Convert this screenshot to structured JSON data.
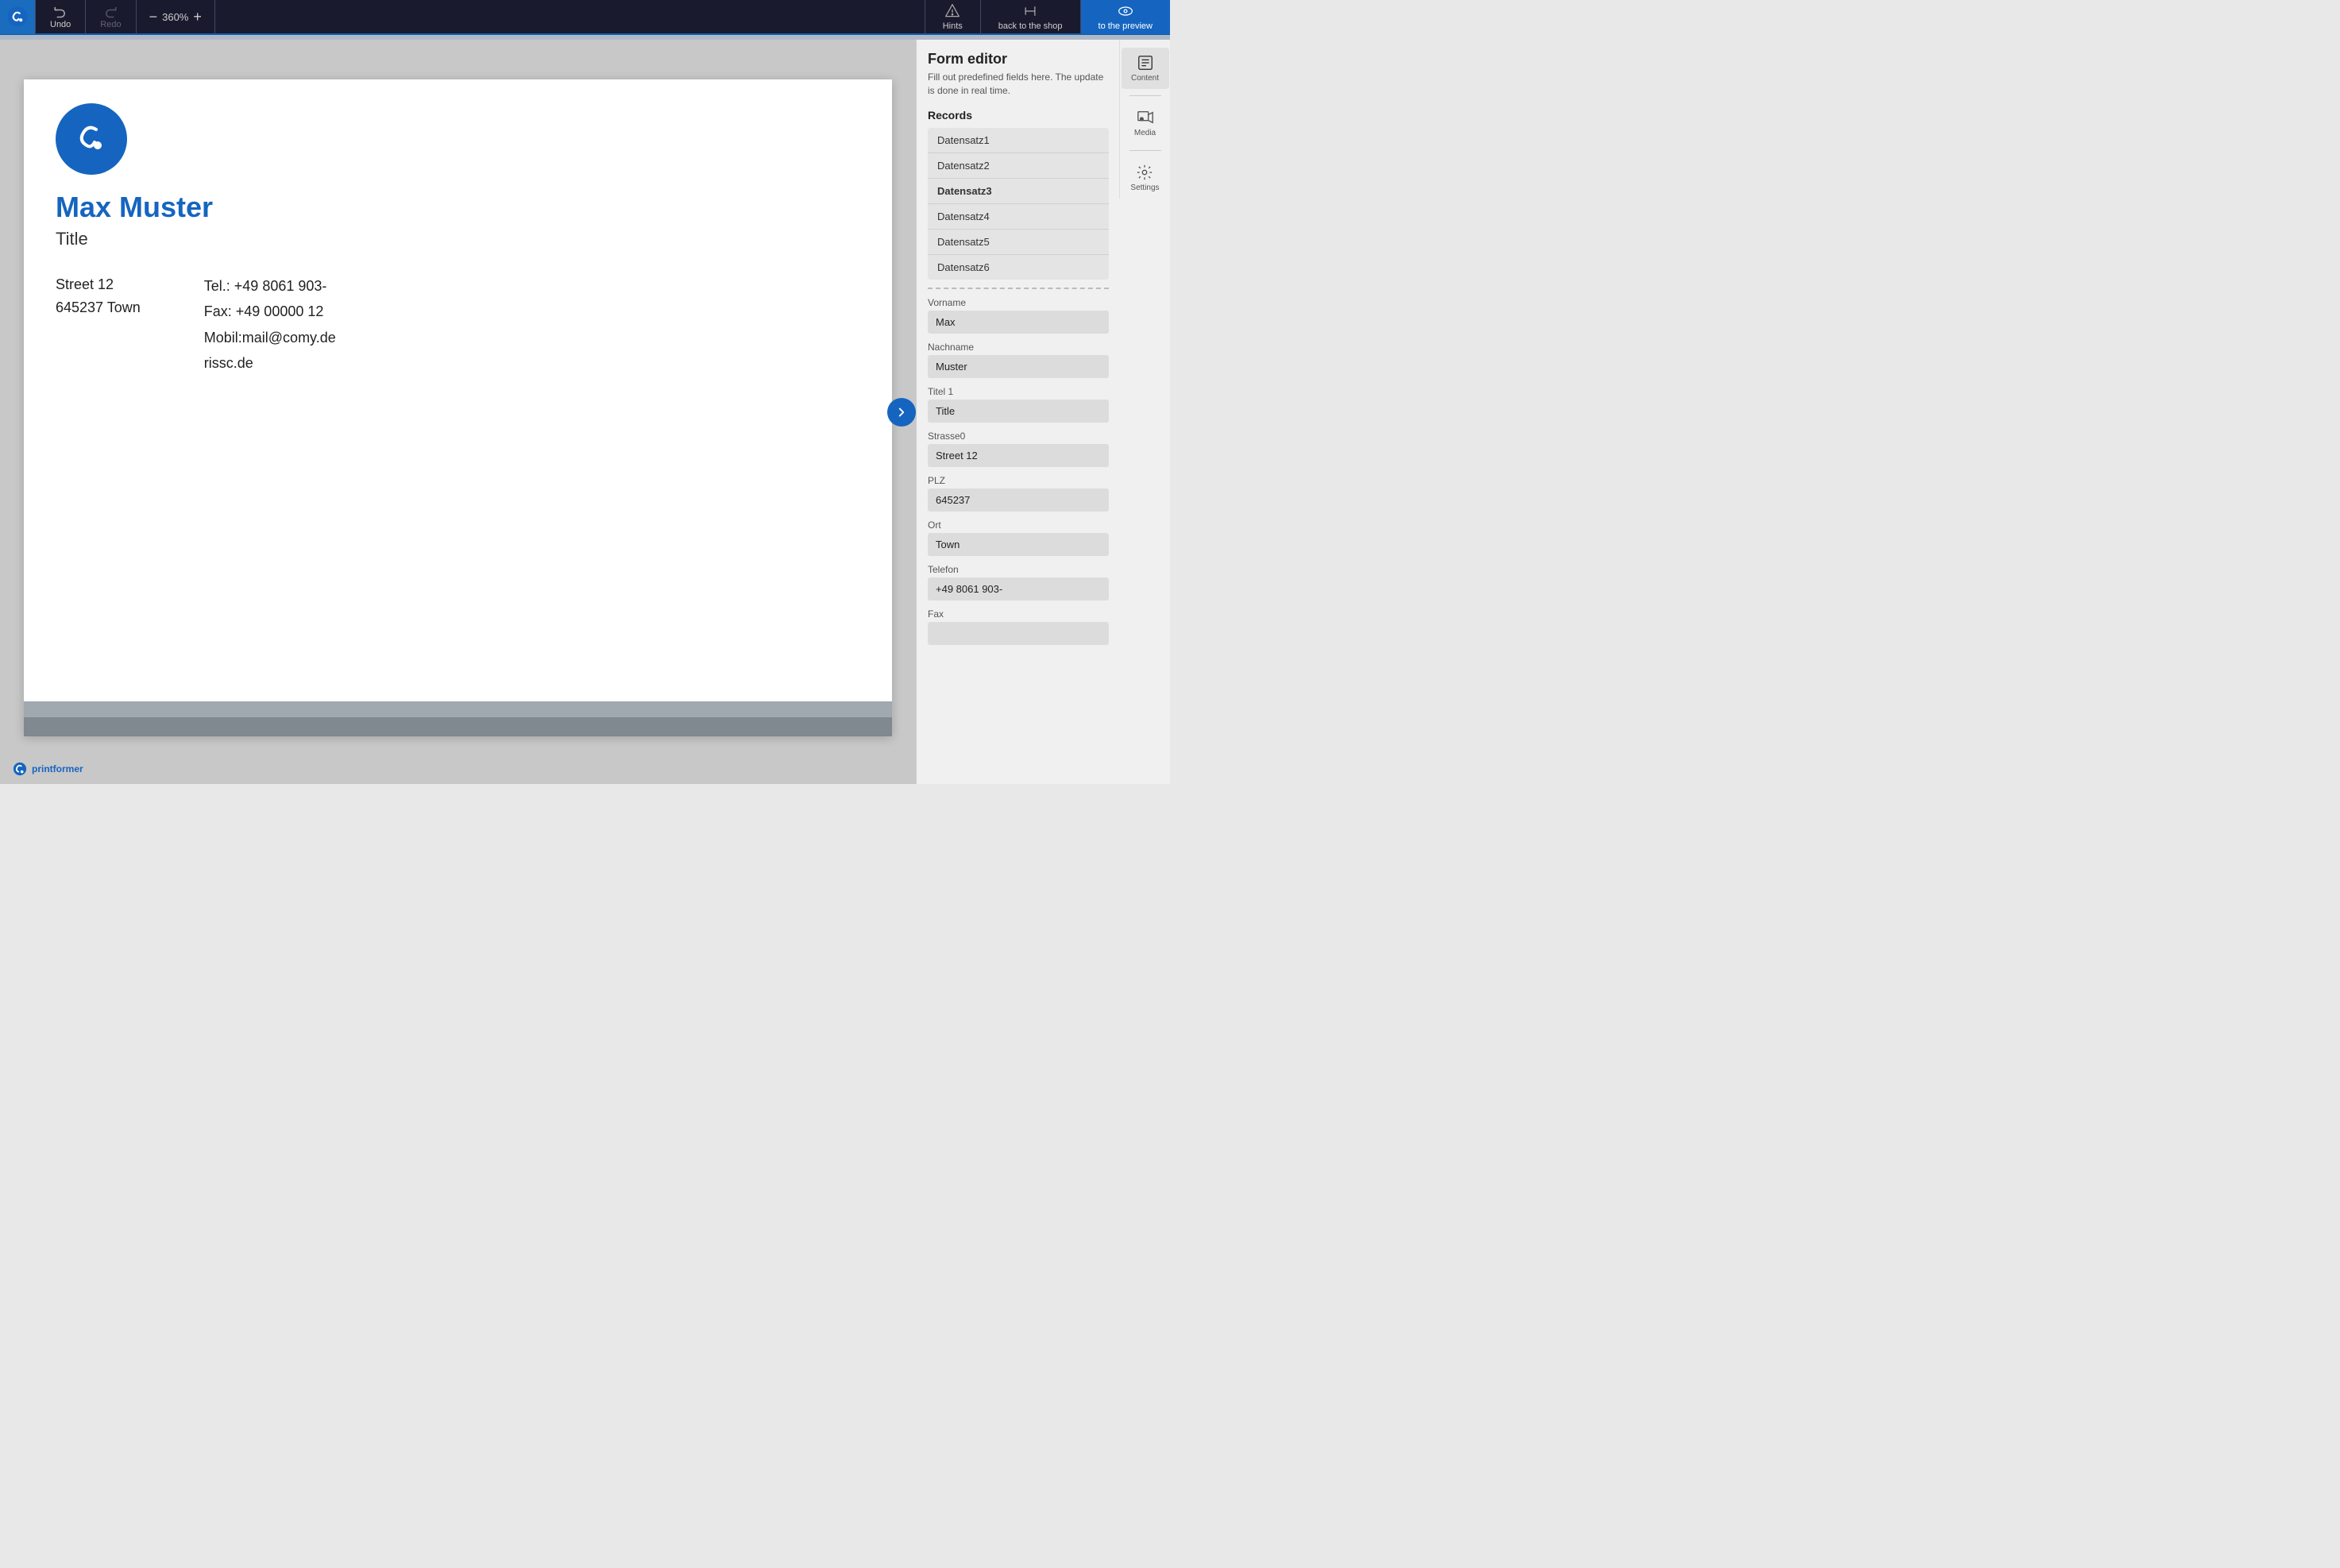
{
  "toolbar": {
    "undo_label": "Undo",
    "redo_label": "Redo",
    "zoom_label": "360%",
    "hints_label": "Hints",
    "back_to_shop_label": "back to the shop",
    "to_preview_label": "to the preview"
  },
  "panel": {
    "title": "Form editor",
    "subtitle": "Fill out predefined fields here. The update is done in real time.",
    "records_label": "Records",
    "records": [
      {
        "id": "r1",
        "label": "Datensatz1",
        "active": false
      },
      {
        "id": "r2",
        "label": "Datensatz2",
        "active": false
      },
      {
        "id": "r3",
        "label": "Datensatz3",
        "active": true
      },
      {
        "id": "r4",
        "label": "Datensatz4",
        "active": false
      },
      {
        "id": "r5",
        "label": "Datensatz5",
        "active": false
      },
      {
        "id": "r6",
        "label": "Datensatz6",
        "active": false
      }
    ],
    "fields": [
      {
        "label": "Vorname",
        "value": "Max"
      },
      {
        "label": "Nachname",
        "value": "Muster"
      },
      {
        "label": "Titel 1",
        "value": "Title"
      },
      {
        "label": "Strasse0",
        "value": "Street 12"
      },
      {
        "label": "PLZ",
        "value": "645237"
      },
      {
        "label": "Ort",
        "value": "Town"
      },
      {
        "label": "Telefon",
        "value": "+49 8061 903-"
      },
      {
        "label": "Fax",
        "value": ""
      }
    ],
    "content_label": "Content",
    "media_label": "Media",
    "settings_label": "Settings"
  },
  "card": {
    "name": "Max Muster",
    "title": "Title",
    "street": "Street 12",
    "city": "645237 Town",
    "tel": "Tel.: +49 8061 903-",
    "fax": "Fax:  +49 00000 12",
    "mobile": "Mobil:mail@comy.de",
    "website": "rissc.de"
  },
  "footer": {
    "brand": "printformer"
  }
}
